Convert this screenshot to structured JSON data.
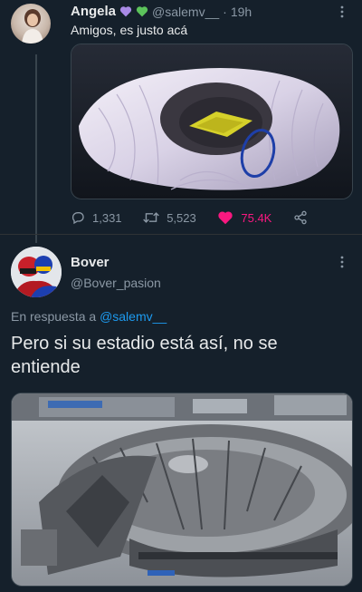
{
  "tweet1": {
    "name": "Angela",
    "badges": [
      "purple-heart",
      "green-heart"
    ],
    "badge_colors": [
      "#a98ae6",
      "#5cc35b"
    ],
    "handle": "@salemv__",
    "separator": "·",
    "time": "19h",
    "text": "Amigos, es justo acá",
    "actions": {
      "replies": "1,331",
      "retweets": "5,523",
      "likes": "75.4K"
    },
    "like_color": "#f91880"
  },
  "tweet2": {
    "name": "Bover",
    "handle": "@Bover_pasion",
    "reply_prefix": "En respuesta a",
    "reply_to": "@salemv__",
    "text": "Pero si su estadio está así, no se entiende"
  },
  "colors": {
    "background": "#15202b",
    "secondary_text": "#8b98a5",
    "link": "#1d9bf0"
  }
}
